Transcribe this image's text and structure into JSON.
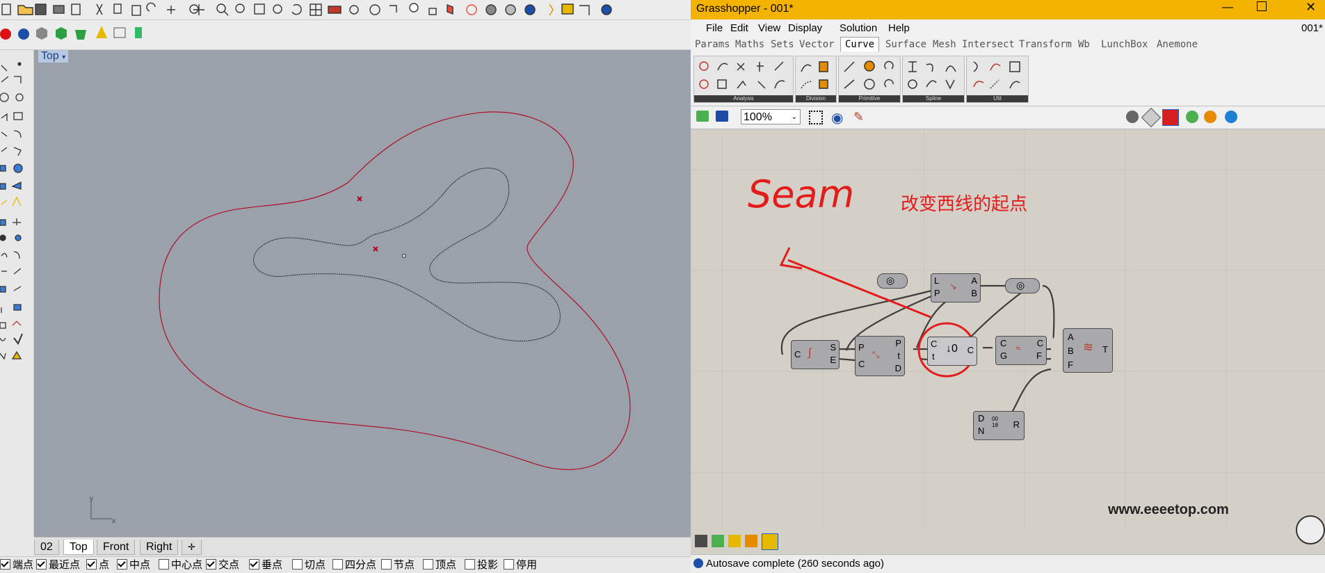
{
  "rhino": {
    "viewport": {
      "name": "Top",
      "axis_x": "x",
      "axis_y": "y"
    },
    "view_tabs": [
      "02",
      "Top",
      "Front",
      "Right"
    ],
    "active_view_tab": "Top",
    "osnaps": [
      {
        "label": "端点",
        "checked": true
      },
      {
        "label": "最近点",
        "checked": true
      },
      {
        "label": "点",
        "checked": true
      },
      {
        "label": "中点",
        "checked": true
      },
      {
        "label": "中心点",
        "checked": false
      },
      {
        "label": "交点",
        "checked": true
      },
      {
        "label": "垂点",
        "checked": true
      },
      {
        "label": "切点",
        "checked": false
      },
      {
        "label": "四分点",
        "checked": false
      },
      {
        "label": "节点",
        "checked": false
      },
      {
        "label": "顶点",
        "checked": false
      },
      {
        "label": "投影",
        "checked": false
      },
      {
        "label": "停用",
        "checked": false
      }
    ]
  },
  "grasshopper": {
    "title": "Grasshopper - 001*",
    "doc_name": "001*",
    "menu": [
      "File",
      "Edit",
      "View",
      "Display",
      "Solution",
      "Help"
    ],
    "tabs": [
      "Params",
      "Maths",
      "Sets",
      "Vector",
      "Curve",
      "Surface",
      "Mesh",
      "Intersect",
      "Transform",
      "Wb",
      "LunchBox",
      "Anemone"
    ],
    "active_tab": "Curve",
    "groups": [
      "Analysis",
      "Division",
      "Primitive",
      "Spline",
      "Util"
    ],
    "zoom": "100%",
    "status": "Autosave complete (260 seconds ago)",
    "annotation_seam": "Seam",
    "annotation_cn": "改变西线的起点",
    "watermark": "www.eeeetop.com",
    "nodes": {
      "n1": {
        "inputs": [
          "L",
          "P"
        ],
        "outputs": [
          "A",
          "B"
        ]
      },
      "n2": {
        "inputs": [
          "C"
        ],
        "outputs": [
          "S",
          "E"
        ]
      },
      "n3": {
        "inputs": [
          "P",
          "C"
        ],
        "outputs": [
          "P",
          "t",
          "D"
        ]
      },
      "n4": {
        "inputs": [
          "C",
          "t"
        ],
        "outputs": [
          "C"
        ]
      },
      "n5": {
        "inputs": [
          "C",
          "G"
        ],
        "outputs": [
          "C",
          "F"
        ]
      },
      "n6": {
        "inputs": [
          "A",
          "B",
          "F"
        ],
        "outputs": [
          "T"
        ]
      },
      "n7": {
        "inputs": [
          "D",
          "N"
        ],
        "outputs": [
          "R"
        ],
        "center": "00\n18"
      }
    },
    "colors": {
      "title_bar": "#f3b300",
      "canvas": "#d4d0c8",
      "annotation": "#e31b1b",
      "curve_outer": "#b3001b"
    }
  }
}
